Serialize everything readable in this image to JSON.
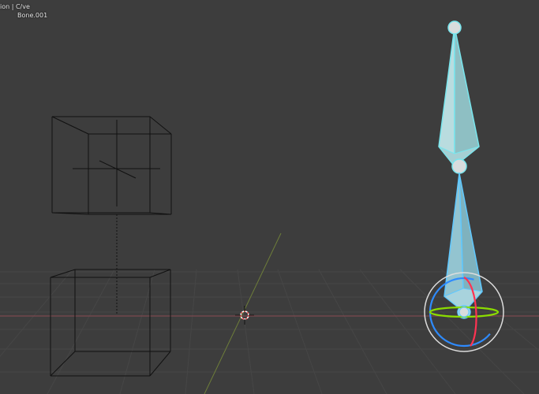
{
  "viewport": {
    "mode_text": "ion | C/ve",
    "object_name": "Bone.001"
  },
  "colors": {
    "background": "#3d3d3d",
    "grid_line": "#464646",
    "x_axis": "#8a4a52",
    "y_axis": "#6d7d3a",
    "wireframe": "#111111",
    "bone_fill": "#b9dcdf",
    "bone_outline": "#78e6ee",
    "bone_active_outline": "#5fc8ff",
    "gizmo_x": "#ff3352",
    "gizmo_y": "#8bdc00",
    "gizmo_z": "#2e8bff",
    "gizmo_ring": "#dddddd"
  },
  "icons": {
    "cursor": "3d-cursor-icon",
    "rotate_gizmo": "rotate-gizmo-icon"
  }
}
